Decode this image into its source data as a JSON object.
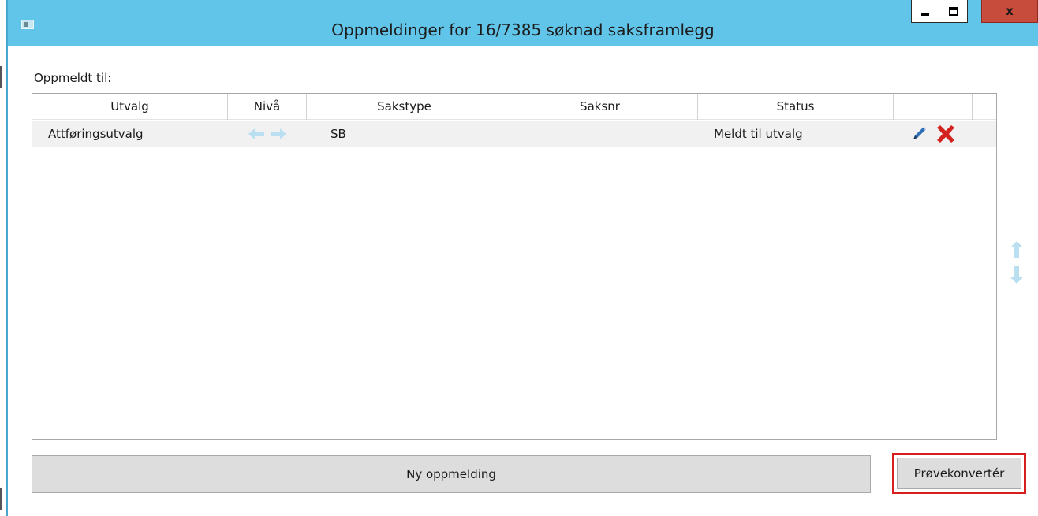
{
  "window": {
    "title": "Oppmeldinger for 16/7385 søknad saksframlegg",
    "minimize_glyph": "minimize-icon",
    "maximize_glyph": "maximize-icon",
    "close_label": "x"
  },
  "section_label": "Oppmeldt til:",
  "grid": {
    "columns": [
      "Utvalg",
      "Nivå",
      "Sakstype",
      "Saksnr",
      "Status",
      ""
    ],
    "rows": [
      {
        "utvalg": "Attføringsutvalg",
        "niva_icons": [
          "arrow-left-icon",
          "arrow-right-icon"
        ],
        "sakstype": "SB",
        "saksnr": "",
        "status": "Meldt til utvalg",
        "actions": [
          "pencil-icon",
          "delete-x-icon"
        ]
      }
    ]
  },
  "side_controls": [
    "arrow-up-icon",
    "arrow-down-icon"
  ],
  "buttons": {
    "new_label": "Ny oppmelding",
    "convert_label": "Prøvekonvertér"
  },
  "colors": {
    "titlebar": "#61c5e9",
    "close_button": "#c74c3c",
    "highlight_outline": "#d61e1e",
    "disabled_arrow": "#b9dff0"
  }
}
